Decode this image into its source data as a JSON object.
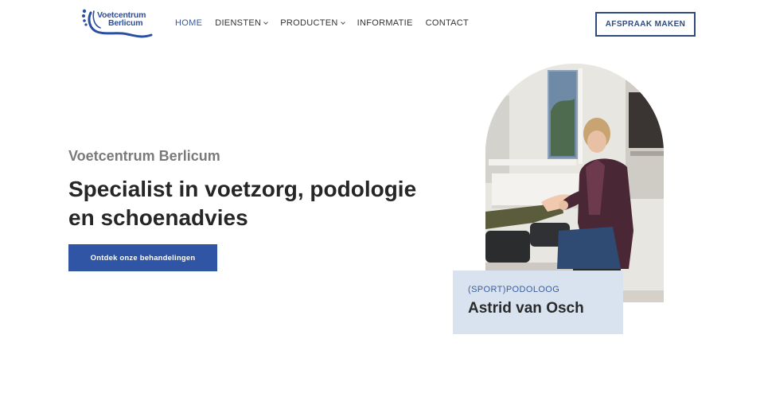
{
  "brand": {
    "logo_line1": "Voetcentrum",
    "logo_line2": "Berlicum",
    "logo_color": "#2a4ea0"
  },
  "nav": {
    "items": [
      {
        "label": "HOME",
        "active": true,
        "has_dropdown": false
      },
      {
        "label": "DIENSTEN",
        "active": false,
        "has_dropdown": true
      },
      {
        "label": "PRODUCTEN",
        "active": false,
        "has_dropdown": true
      },
      {
        "label": "INFORMATIE",
        "active": false,
        "has_dropdown": false
      },
      {
        "label": "CONTACT",
        "active": false,
        "has_dropdown": false
      }
    ],
    "cta_label": "AFSPRAAK MAKEN"
  },
  "hero": {
    "subtitle": "Voetcentrum Berlicum",
    "title": "Specialist in voetzorg, podologie en schoenadvies",
    "button_label": "Ontdek onze behandelingen",
    "button_color": "#2f55a4"
  },
  "profile": {
    "role": "(SPORT)PODOLOOG",
    "name": "Astrid van Osch",
    "card_color": "#d9e3ef"
  }
}
